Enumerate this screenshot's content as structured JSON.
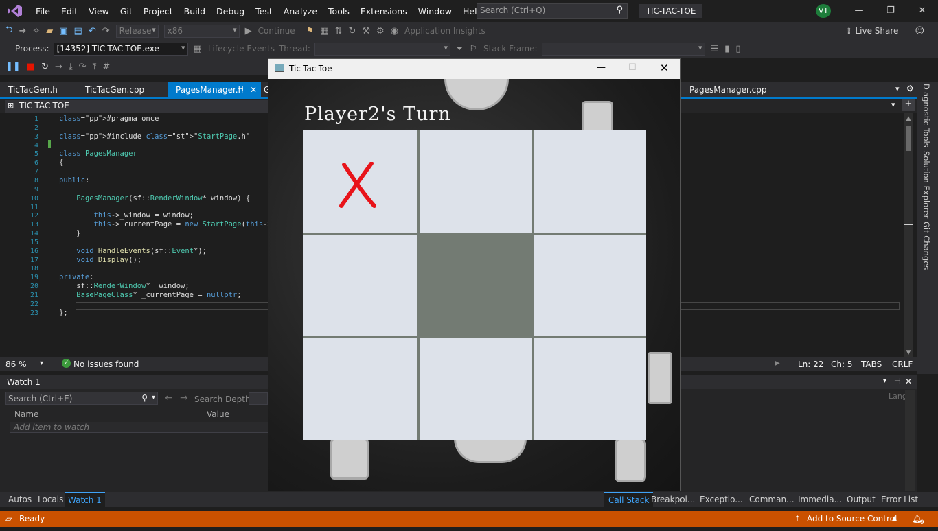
{
  "menu": [
    "File",
    "Edit",
    "View",
    "Git",
    "Project",
    "Build",
    "Debug",
    "Test",
    "Analyze",
    "Tools",
    "Extensions",
    "Window",
    "Help"
  ],
  "search": {
    "placeholder": "Search (Ctrl+Q)"
  },
  "solution_name": "TIC-TAC-TOE",
  "user_initials": "VT",
  "toolbar": {
    "config": "Release",
    "platform": "x86",
    "continue_label": "Continue",
    "app_insights": "Application Insights",
    "live_share": "Live Share"
  },
  "debugbar": {
    "process_label": "Process:",
    "process_value": "[14352] TIC-TAC-TOE.exe",
    "lifecycle": "Lifecycle Events",
    "thread_label": "Thread:",
    "stack_frame_label": "Stack Frame:"
  },
  "editor_tabs": [
    "TicTacGen.h",
    "TicTacGen.cpp",
    "PagesManager.h",
    "G"
  ],
  "right_tab": "PagesManager.cpp",
  "nav_scope": "TIC-TAC-TOE",
  "code_lines": [
    {
      "n": "1",
      "t": "#pragma once"
    },
    {
      "n": "2",
      "t": ""
    },
    {
      "n": "3",
      "t": "#include \"StartPage.h\""
    },
    {
      "n": "4",
      "t": ""
    },
    {
      "n": "5",
      "t": "class PagesManager"
    },
    {
      "n": "6",
      "t": "{"
    },
    {
      "n": "7",
      "t": ""
    },
    {
      "n": "8",
      "t": "public:"
    },
    {
      "n": "9",
      "t": ""
    },
    {
      "n": "10",
      "t": "    PagesManager(sf::RenderWindow* window) {"
    },
    {
      "n": "11",
      "t": ""
    },
    {
      "n": "12",
      "t": "        this->_window = window;"
    },
    {
      "n": "13",
      "t": "        this->_currentPage = new StartPage(this->_"
    },
    {
      "n": "14",
      "t": "    }"
    },
    {
      "n": "15",
      "t": ""
    },
    {
      "n": "16",
      "t": "    void HandleEvents(sf::Event*);"
    },
    {
      "n": "17",
      "t": "    void Display();"
    },
    {
      "n": "18",
      "t": ""
    },
    {
      "n": "19",
      "t": "private:"
    },
    {
      "n": "20",
      "t": "    sf::RenderWindow* _window;"
    },
    {
      "n": "21",
      "t": "    BasePageClass* _currentPage = nullptr;"
    },
    {
      "n": "22",
      "t": ""
    },
    {
      "n": "23",
      "t": "};"
    }
  ],
  "editor_status": {
    "zoom": "86 %",
    "issues": "No issues found",
    "ln": "Ln: 22",
    "ch": "Ch: 5",
    "tabs": "TABS",
    "eol": "CRLF"
  },
  "watch": {
    "title": "Watch 1",
    "search_placeholder": "Search (Ctrl+E)",
    "search_depth": "Search Depth:",
    "col_name": "Name",
    "col_value": "Value",
    "add_item": "Add item to watch",
    "col_lang": "Lang"
  },
  "bottom_tabs_left": [
    "Autos",
    "Locals",
    "Watch 1"
  ],
  "bottom_tabs_right": [
    "Call Stack",
    "Breakpoi...",
    "Exceptio...",
    "Comman...",
    "Immedia...",
    "Output",
    "Error List"
  ],
  "right_rail": [
    "Diagnostic Tools",
    "Solution Explorer",
    "Git Changes"
  ],
  "statusbar": {
    "ready": "Ready",
    "source_control": "Add to Source Control",
    "notifications": "9"
  },
  "game": {
    "window_title": "Tic-Tac-Toe",
    "turn_text": "Player2's Turn",
    "board": [
      "X",
      "",
      "",
      "",
      "",
      "",
      "",
      "",
      ""
    ],
    "highlight_cell": 4,
    "mark_color": "#e8141a"
  }
}
